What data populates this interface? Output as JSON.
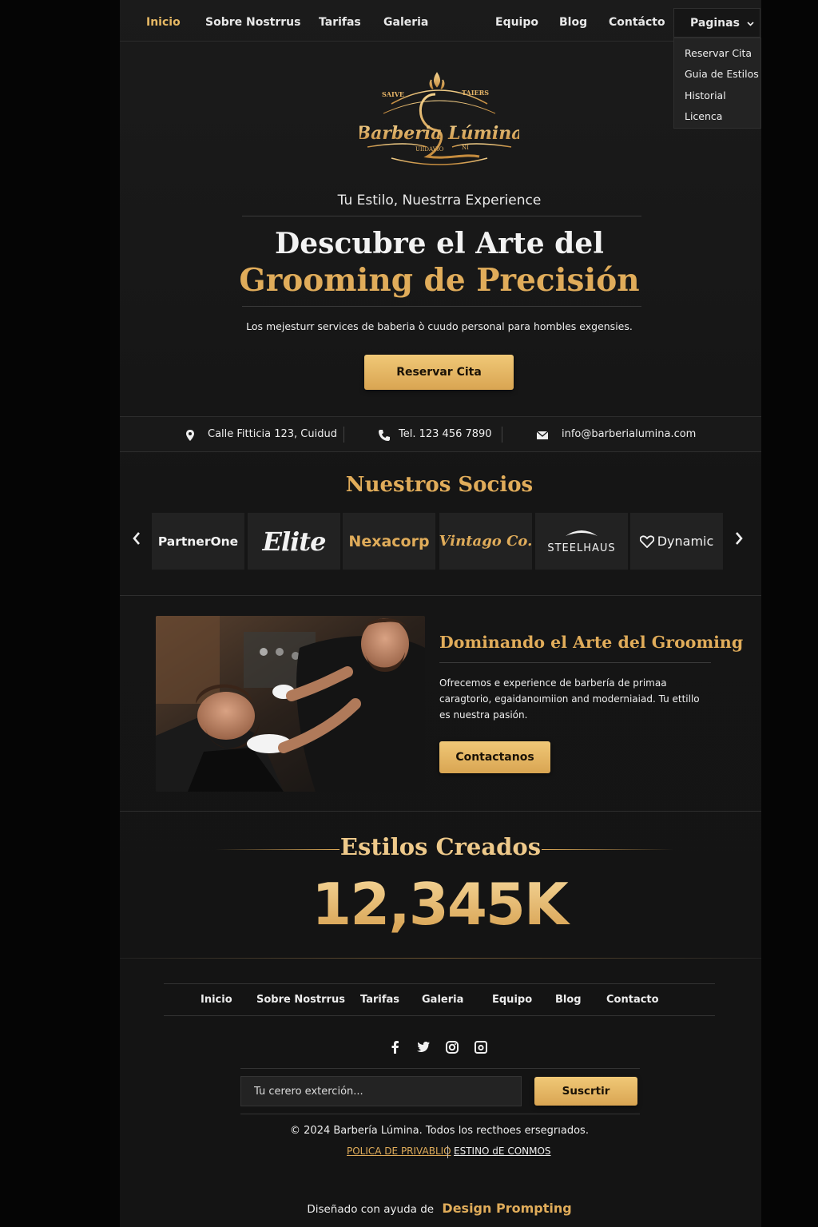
{
  "nav": {
    "items": [
      "Inicio",
      "Sobre Nostrrus",
      "Tarifas",
      "Galeria",
      "Equipo",
      "Blog",
      "Contácto"
    ],
    "active": "Inicio",
    "pages_label": "Paginas",
    "dropdown": [
      "Reservar Cita",
      "Guia de Estilos",
      "Historial",
      "Licenca"
    ]
  },
  "logo": {
    "name": "Barberia Lúmina",
    "top_left": "SAIVE",
    "top_right": "TAIERS",
    "bottom": "UIIDAVIO",
    "bottom_right": "NI"
  },
  "hero": {
    "tagline": "Tu Estilo, Nuestrra Experience",
    "title_line1": "Descubre el Arte del",
    "title_line2": "Grooming de Precisión",
    "subtitle": "Los mejesturr services de baberia ò cuudo personal para hombles exgensies.",
    "cta": "Reservar Cita"
  },
  "contact": {
    "address": "Calle Fitticia 123, Cuidud",
    "phone": "Tel. 123 456 7890",
    "email": "info@barberialumina.com"
  },
  "partners": {
    "title": "Nuestros Socios",
    "items": [
      "PartnerOne",
      "Elite",
      "Nexacorp",
      "Vintago Co.",
      "STEELHAUS",
      "Dynamic"
    ]
  },
  "feature": {
    "title": "Dominando el Arte del Grooming",
    "text": "Ofrecemos e experience de barbería de primaa caragtorio, egaidanoımiion and moderniaiad. Tu ettillo es nuestra pasión.",
    "cta": "Contactanos"
  },
  "stats": {
    "title": "Estilos Creados",
    "value": "12,345K"
  },
  "footer": {
    "nav": [
      "Inicio",
      "Sobre Nostrrus",
      "Tarifas",
      "Galeria",
      "Equipo",
      "Blog",
      "Contacto"
    ],
    "social": [
      "facebook-icon",
      "twitter-icon",
      "instagram-icon",
      "camera-icon"
    ],
    "newsletter_placeholder": "Tu cerero exterción...",
    "subscribe": "Suscrtir",
    "copyright": "© 2024 Barbería Lúmina. Todos los recthoes ersegrıados.",
    "privacy": "POLICA DE PRIVABLIO",
    "terms": "ESTINO dE CONMOS",
    "credit_prefix": "Diseñado con ayuda de",
    "credit_brand": "Design Prompting"
  },
  "colors": {
    "accent": "#e0ac5a",
    "background": "#171717",
    "outer": "#050505"
  }
}
